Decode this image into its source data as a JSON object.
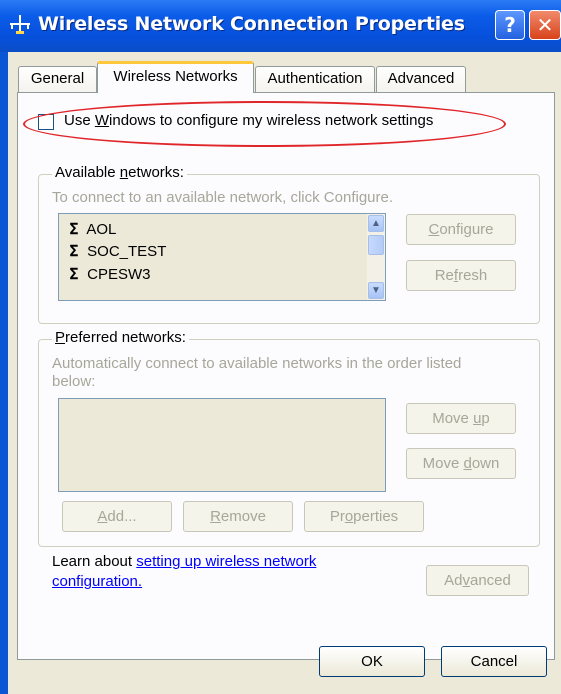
{
  "window": {
    "title": "Wireless Network Connection Properties",
    "help_glyph": "?",
    "close_glyph": "✕"
  },
  "tabs": [
    {
      "label": "General",
      "active": false
    },
    {
      "label": "Wireless Networks",
      "active": true
    },
    {
      "label": "Authentication",
      "active": false
    },
    {
      "label": "Advanced",
      "active": false
    }
  ],
  "use_windows_checkbox": {
    "label_prefix": "Use ",
    "label_accel": "W",
    "label_rest": "indows to configure my wireless network settings",
    "checked": false
  },
  "available": {
    "title_prefix": "Available ",
    "title_accel": "n",
    "title_rest": "etworks:",
    "hint": "To connect to an available network, click Configure.",
    "networks": [
      "AOL",
      "SOC_TEST",
      "CPESW3"
    ],
    "configure_accel": "C",
    "configure_rest": "onfigure",
    "refresh_prefix": "Re",
    "refresh_accel": "f",
    "refresh_rest": "resh"
  },
  "preferred": {
    "title_accel": "P",
    "title_rest": "referred networks:",
    "hint_line1": "Automatically connect to available networks in the order listed",
    "hint_line2": "below:",
    "moveup_prefix": "Move ",
    "moveup_accel": "u",
    "moveup_rest": "p",
    "movedown_prefix": "Move ",
    "movedown_accel": "d",
    "movedown_rest": "own",
    "add_accel": "A",
    "add_rest": "dd...",
    "remove_accel": "R",
    "remove_rest": "emove",
    "properties_prefix": "Pr",
    "properties_accel": "o",
    "properties_rest": "perties"
  },
  "learn": {
    "prefix": "Learn about ",
    "link_line1": "setting up wireless network",
    "link_line2": "configuration."
  },
  "advanced_button": {
    "prefix": "Ad",
    "accel": "v",
    "rest": "anced"
  },
  "footer": {
    "ok": "OK",
    "cancel": "Cancel"
  }
}
